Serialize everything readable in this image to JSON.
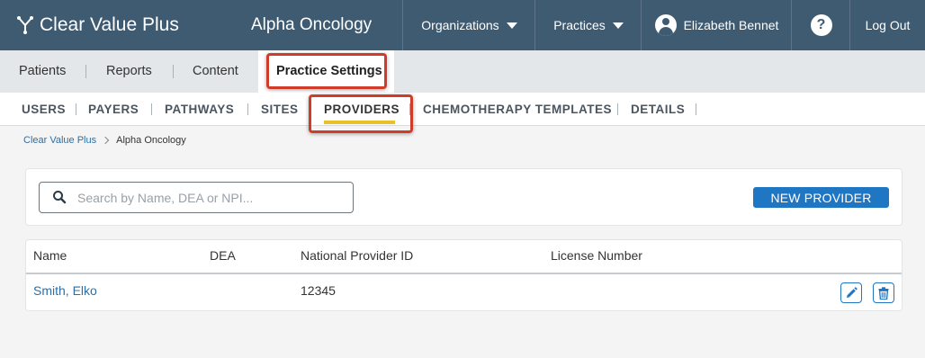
{
  "app": {
    "logo_text": "Clear Value Plus",
    "practice_name": "Alpha Oncology"
  },
  "topnav": {
    "organizations": "Organizations",
    "practices": "Practices",
    "user_name": "Elizabeth Bennet",
    "help_glyph": "?",
    "logout": "Log Out"
  },
  "mainnav": {
    "items": [
      "Patients",
      "Reports",
      "Content",
      "Practice Settings"
    ],
    "active": "Practice Settings"
  },
  "subnav": {
    "items": [
      "USERS",
      "PAYERS",
      "PATHWAYS",
      "SITES",
      "PROVIDERS",
      "CHEMOTHERAPY TEMPLATES",
      "DETAILS"
    ],
    "active": "PROVIDERS"
  },
  "breadcrumb": {
    "root": "Clear Value Plus",
    "current": "Alpha Oncology"
  },
  "search": {
    "placeholder": "Search by Name, DEA or NPI...",
    "value": ""
  },
  "actions": {
    "new_provider": "NEW PROVIDER"
  },
  "table": {
    "headers": [
      "Name",
      "DEA",
      "National Provider ID",
      "License Number"
    ],
    "rows": [
      {
        "name": "Smith, Elko",
        "dea": "",
        "npi": "12345",
        "license": ""
      }
    ]
  },
  "colors": {
    "topbar": "#3f5b72",
    "accent": "#1f76c3",
    "active_underline": "#e8c02a",
    "highlight": "#d13b2a"
  },
  "icons": [
    "logo-icon",
    "caret-down-icon",
    "user-avatar-icon",
    "help-icon",
    "search-icon",
    "chevron-right-icon",
    "edit-icon",
    "trash-icon"
  ]
}
